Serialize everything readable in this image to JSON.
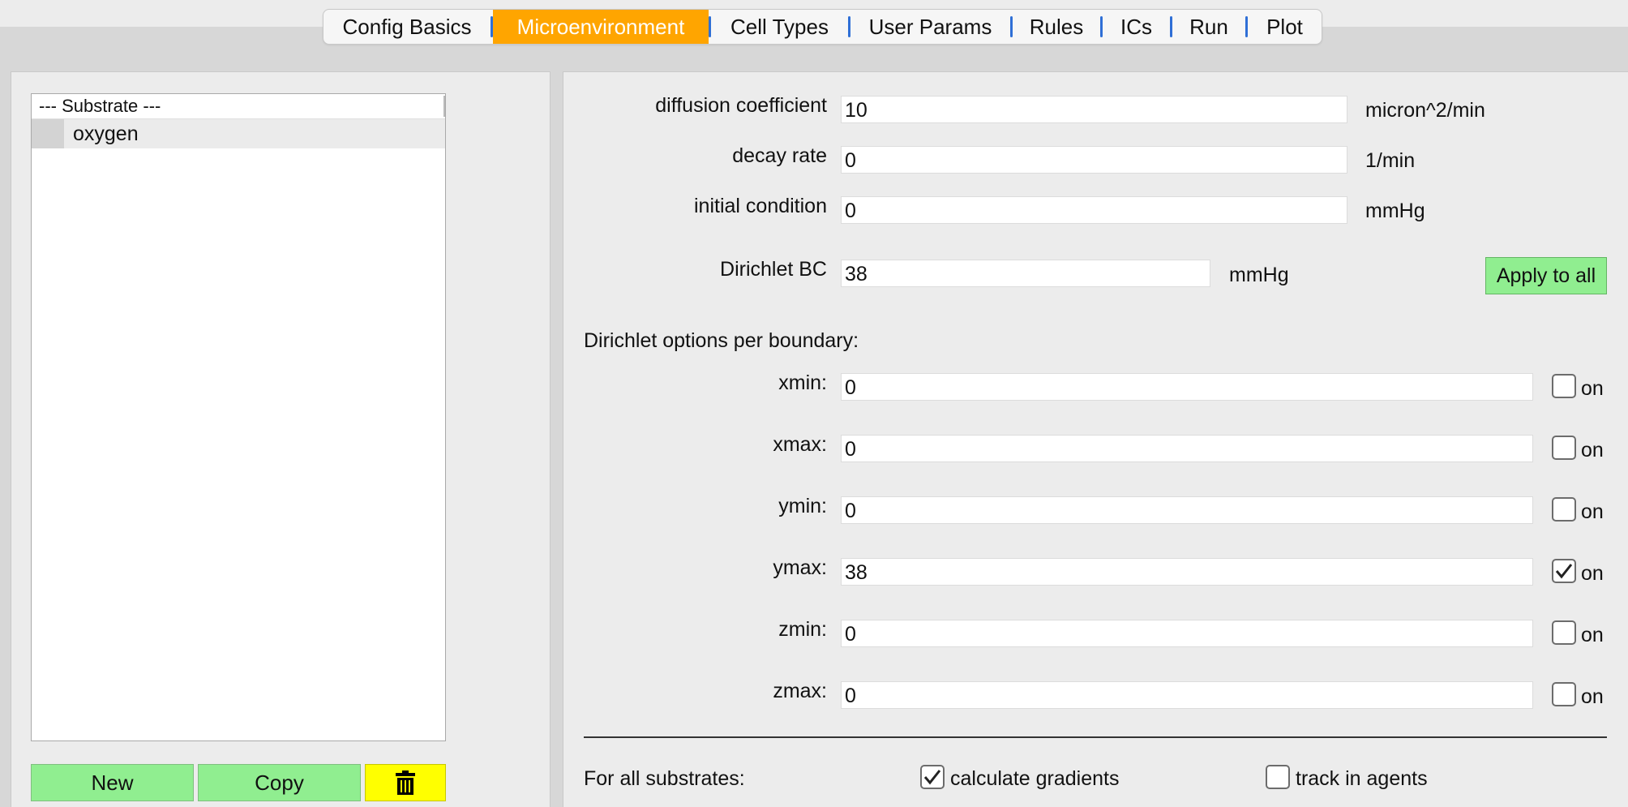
{
  "tabs": [
    {
      "label": "Config Basics",
      "active": false
    },
    {
      "label": "Microenvironment",
      "active": true
    },
    {
      "label": "Cell Types",
      "active": false
    },
    {
      "label": "User Params",
      "active": false
    },
    {
      "label": "Rules",
      "active": false
    },
    {
      "label": "ICs",
      "active": false
    },
    {
      "label": "Run",
      "active": false
    },
    {
      "label": "Plot",
      "active": false
    }
  ],
  "substrates": {
    "header": "---  Substrate ---",
    "items": [
      {
        "label": "oxygen",
        "selected": true
      }
    ]
  },
  "actions": {
    "new_label": "New",
    "copy_label": "Copy",
    "delete_icon": "trash-icon"
  },
  "params": {
    "diffusion": {
      "label": "diffusion coefficient",
      "value": "10",
      "unit": "micron^2/min"
    },
    "decay": {
      "label": "decay rate",
      "value": "0",
      "unit": "1/min"
    },
    "initial": {
      "label": "initial condition",
      "value": "0",
      "unit": "mmHg"
    },
    "dirichlet": {
      "label": "Dirichlet BC",
      "value": "38",
      "unit": "mmHg"
    }
  },
  "apply_label": "Apply to all",
  "boundary_title": "Dirichlet options per boundary:",
  "boundaries": {
    "xmin": {
      "label": "xmin:",
      "value": "0",
      "on_label": "on",
      "checked": false
    },
    "xmax": {
      "label": "xmax:",
      "value": "0",
      "on_label": "on",
      "checked": false
    },
    "ymin": {
      "label": "ymin:",
      "value": "0",
      "on_label": "on",
      "checked": false
    },
    "ymax": {
      "label": "ymax:",
      "value": "38",
      "on_label": "on",
      "checked": true
    },
    "zmin": {
      "label": "zmin:",
      "value": "0",
      "on_label": "on",
      "checked": false
    },
    "zmax": {
      "label": "zmax:",
      "value": "0",
      "on_label": "on",
      "checked": false
    }
  },
  "all_substrates": {
    "label": "For all substrates:",
    "calc_gradients": {
      "label": "calculate gradients",
      "checked": true
    },
    "track_agents": {
      "label": "track in agents",
      "checked": false
    }
  },
  "colors": {
    "active_tab": "#ffa500",
    "button_green": "#90ee90",
    "button_yellow": "#ffff00",
    "tab_separator": "#2f6fd6"
  }
}
